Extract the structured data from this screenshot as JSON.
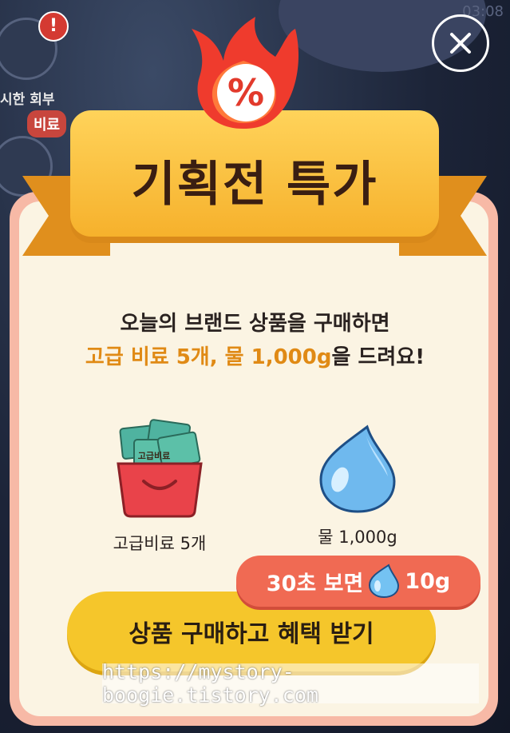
{
  "status": {
    "time": "03:08"
  },
  "background": {
    "alert": "!",
    "side_label": "시한 회부",
    "side_pill": "비료"
  },
  "popup": {
    "close_label": "close",
    "badge_symbol": "%",
    "title": "기획전 특가",
    "headline_line1": "오늘의 브랜드 상품을 구매하면",
    "headline_line2_highlight": "고급 비료 5개, 물 1,000g",
    "headline_line2_rest": "을 드려요!",
    "rewards": [
      {
        "label": "고급비료 5개",
        "pack_text": "고급비료"
      },
      {
        "label": "물 1,000g"
      }
    ],
    "ad_offer": {
      "prefix": "30초 보면",
      "amount": "10g"
    },
    "cta_label": "상품 구매하고 혜택 받기",
    "watermark": "https://mystory-boogie.tistory.com"
  },
  "colors": {
    "accent_orange": "#e08a15",
    "cta_yellow": "#f5c62b",
    "ad_red": "#f06a53",
    "card_border": "#f7b9a6"
  }
}
